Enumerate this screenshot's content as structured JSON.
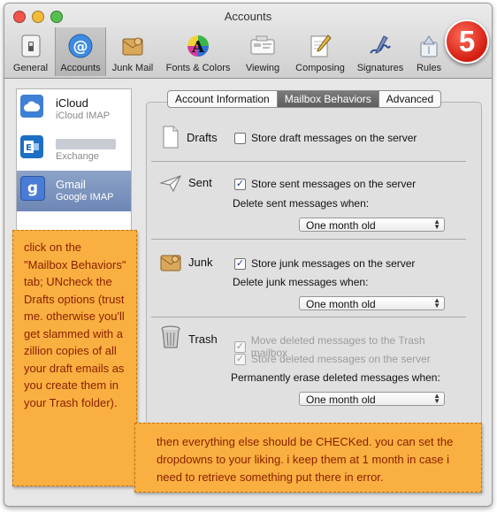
{
  "window": {
    "title": "Accounts"
  },
  "step_badge": "5",
  "toolbar": {
    "items": [
      {
        "label": "General",
        "icon": "general-switch-icon"
      },
      {
        "label": "Accounts",
        "icon": "at-sign-icon",
        "selected": true
      },
      {
        "label": "Junk Mail",
        "icon": "junk-mail-icon"
      },
      {
        "label": "Fonts & Colors",
        "icon": "fonts-colors-icon"
      },
      {
        "label": "Viewing",
        "icon": "viewing-icon"
      },
      {
        "label": "Composing",
        "icon": "composing-icon"
      },
      {
        "label": "Signatures",
        "icon": "signatures-icon"
      },
      {
        "label": "Rules",
        "icon": "rules-icon"
      }
    ]
  },
  "accounts": [
    {
      "name": "iCloud",
      "sub": "iCloud IMAP",
      "icon": "cloud-icon"
    },
    {
      "name": "",
      "sub": "Exchange",
      "icon": "exchange-icon"
    },
    {
      "name": "Gmail",
      "sub": "Google IMAP",
      "icon": "google-icon",
      "selected": true
    }
  ],
  "tabs": [
    {
      "label": "Account Information"
    },
    {
      "label": "Mailbox Behaviors",
      "selected": true
    },
    {
      "label": "Advanced"
    }
  ],
  "drafts": {
    "title": "Drafts",
    "store_label": "Store draft messages on the server",
    "store_checked": false
  },
  "sent": {
    "title": "Sent",
    "store_label": "Store sent messages on the server",
    "store_checked": true,
    "delete_label": "Delete sent messages when:",
    "delete_value": "One month old"
  },
  "junk": {
    "title": "Junk",
    "store_label": "Store junk messages on the server",
    "store_checked": true,
    "delete_label": "Delete junk messages when:",
    "delete_value": "One month old"
  },
  "trash": {
    "title": "Trash",
    "move_label": "Move deleted messages to the Trash mailbox",
    "move_checked": true,
    "store_label": "Store deleted messages on the server",
    "store_checked": true,
    "erase_label": "Permanently erase deleted messages when:",
    "erase_value": "One month old"
  },
  "notes": {
    "left": "click on the \"Mailbox Behaviors\" tab; UNcheck the Drafts options (trust me. otherwise you'll get slammed with a zillion copies of all your draft emails as you create them in your Trash folder).",
    "bottom": "then everything else should be CHECKed. you can set the dropdowns to your liking. i keep them at 1 month in case i need to retrieve something put there in error."
  },
  "colors": {
    "note_fill": "#fab041",
    "note_text": "#8a1e00",
    "badge_red": "#d21d10",
    "selection_blue": "#6d86b5"
  }
}
